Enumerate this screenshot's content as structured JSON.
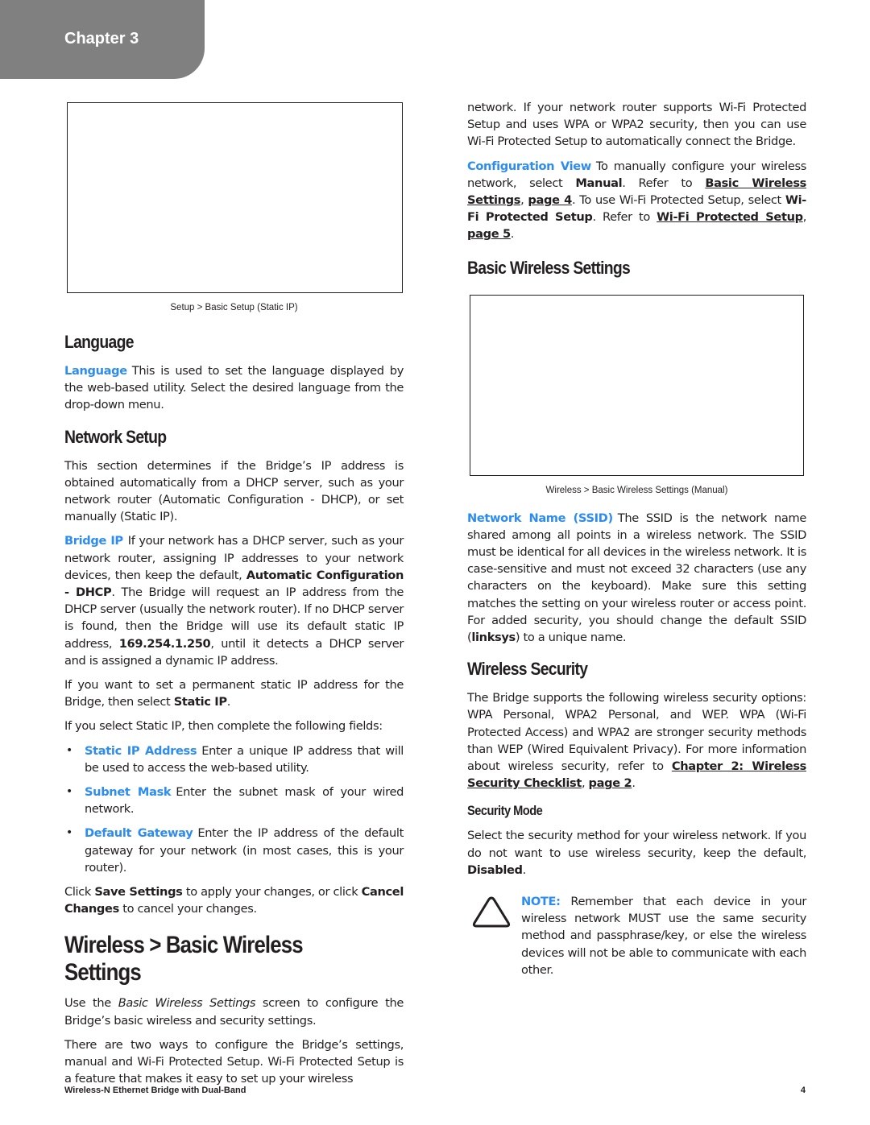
{
  "chapter_tab": "Chapter 3",
  "colors": {
    "accent_blue": "#2d8cf0",
    "tab_gray": "#808080",
    "text": "#231f20"
  },
  "left": {
    "figure_caption": "Setup > Basic Setup (Static IP)",
    "language": {
      "heading": "Language",
      "term": "Language",
      "text": "This is used to set the language displayed by the web-based utility. Select the desired language from the drop-down menu."
    },
    "network_setup": {
      "heading": "Network Setup",
      "intro": "This section determines if the Bridge’s IP address is obtained automatically from a DHCP server, such as your network router (Automatic Configuration - DHCP), or set manually (Static IP).",
      "bridge_ip": {
        "term": "Bridge IP",
        "t1": "If your network has a DHCP server, such as your network router, assigning IP addresses to your network devices, then keep the default, ",
        "b1": "Automatic Configuration - DHCP",
        "t2": ". The Bridge will request an IP address from the DHCP server (usually the network router). If no DHCP server is found, then the Bridge will use its default static IP address, ",
        "b2": "169.254.1.250",
        "t3": ", until it detects a DHCP server and is assigned a dynamic IP address."
      },
      "static_para": {
        "t1": "If you want to set a permanent static IP address for the Bridge, then select ",
        "b1": "Static IP",
        "t2": "."
      },
      "fields_intro": "If you select Static IP, then complete the following fields:",
      "bullets": [
        {
          "term": "Static IP Address",
          "text": "Enter a unique IP address that will be used to access the web-based utility."
        },
        {
          "term": "Subnet Mask",
          "text": "Enter the subnet mask of your wired network."
        },
        {
          "term": "Default Gateway",
          "text": "Enter the IP address of the default gateway for your network (in most cases, this is your router)."
        }
      ],
      "save_para": {
        "t1": "Click ",
        "b1": "Save Settings",
        "t2": " to apply your changes, or click ",
        "b2": "Cancel Changes",
        "t3": " to cancel your changes."
      }
    },
    "wireless": {
      "heading": "Wireless > Basic Wireless Settings",
      "p1_t1": "Use the ",
      "p1_i": "Basic Wireless Settings",
      "p1_t2": " screen to configure the Bridge’s basic wireless and security settings.",
      "p2": "There are two ways to configure the Bridge’s settings, manual and Wi-Fi Protected Setup. Wi-Fi Protected Setup is a feature that makes it easy to set up your wireless"
    }
  },
  "right": {
    "cont_para": "network. If your network router supports Wi-Fi Protected Setup and uses WPA or WPA2 security, then you can use Wi-Fi Protected Setup to automatically connect the Bridge.",
    "config_view": {
      "term": "Configuration View",
      "t1": "To manually configure your wireless network, select ",
      "b1": "Manual",
      "t2": ". Refer to ",
      "link1": "Basic Wireless Settings",
      "t3": ", ",
      "link2": "page 4",
      "t4": ". To use Wi-Fi Protected Setup, select ",
      "b2": "Wi-Fi Protected Setup",
      "t5": ". Refer to ",
      "link3": "Wi-Fi Protected Setup",
      "t6": ", ",
      "link4": "page 5",
      "t7": "."
    },
    "basic_wireless": {
      "heading": "Basic Wireless Settings",
      "figure_caption": "Wireless > Basic Wireless Settings (Manual)"
    },
    "ssid": {
      "term": "Network Name (SSID)",
      "t1": "The SSID is the network name shared among all points in a wireless network. The SSID must be identical for all devices in the wireless network. It is case-sensitive and must not exceed 32 characters (use any characters on the keyboard). Make sure this setting matches the setting on your wireless router or access point. For added security, you should change the default SSID (",
      "b1": "linksys",
      "t2": ") to a unique name."
    },
    "security": {
      "heading": "Wireless Security",
      "t1": "The Bridge supports the following wireless security options: WPA Personal, WPA2 Personal, and WEP. WPA (Wi-Fi Protected Access) and WPA2 are stronger security methods than WEP (Wired Equivalent Privacy). For more information about wireless security, refer to ",
      "link1": "Chapter 2: Wireless Security Checklist",
      "t2": ", ",
      "link2": "page 2",
      "t3": "."
    },
    "security_mode": {
      "heading": "Security Mode",
      "t1": "Select the security method for your wireless network. If you do not want to use wireless security, keep the default, ",
      "b1": "Disabled",
      "t2": "."
    },
    "note": {
      "label": "NOTE:",
      "text": " Remember that each device in your wireless network MUST use the same security method and passphrase/key, or else the wireless devices will not be able to communicate with each other."
    }
  },
  "footer": {
    "product": "Wireless-N Ethernet Bridge with Dual-Band",
    "page_number": "4"
  }
}
